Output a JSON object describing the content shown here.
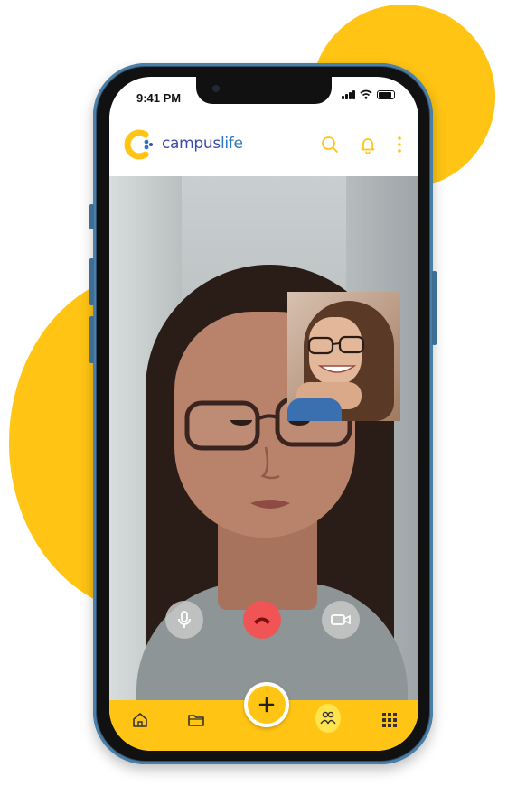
{
  "status_bar": {
    "time": "9:41 PM"
  },
  "app": {
    "brand_part1": "campus",
    "brand_part2": "life",
    "accent_color": "#FFC414",
    "end_call_color": "#F05454"
  },
  "header_icons": [
    "search-icon",
    "bell-icon",
    "more-vertical-icon"
  ],
  "call_controls": [
    "microphone-icon",
    "end-call-icon",
    "video-camera-icon"
  ],
  "bottom_nav": [
    "home-icon",
    "folder-icon",
    "add-icon",
    "people-icon",
    "grid-icon"
  ],
  "bottom_nav_active": "people-icon"
}
